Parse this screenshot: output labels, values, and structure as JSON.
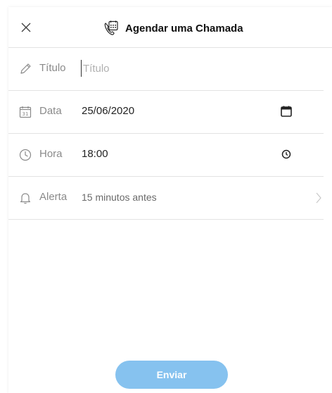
{
  "dialog": {
    "title": "Agendar uma Chamada",
    "close_icon": "close-icon",
    "header_icon": "calendar-call-icon"
  },
  "fields": {
    "title": {
      "label": "Título",
      "placeholder": "Título",
      "value": "",
      "icon": "pencil-icon"
    },
    "date": {
      "label": "Data",
      "value": "25/06/2020",
      "icon": "calendar-31-icon",
      "action_icon": "calendar-picker-icon"
    },
    "time": {
      "label": "Hora",
      "value": "18:00",
      "icon": "clock-icon",
      "action_icon": "clock-picker-icon"
    },
    "alert": {
      "label": "Alerta",
      "value": "15 minutos antes",
      "icon": "bell-icon",
      "action_icon": "chevron-right-icon"
    }
  },
  "actions": {
    "send_label": "Enviar"
  },
  "colors": {
    "send_button": "#86c2ef",
    "divider": "#e3e3e3",
    "label": "#8a8a8a"
  }
}
